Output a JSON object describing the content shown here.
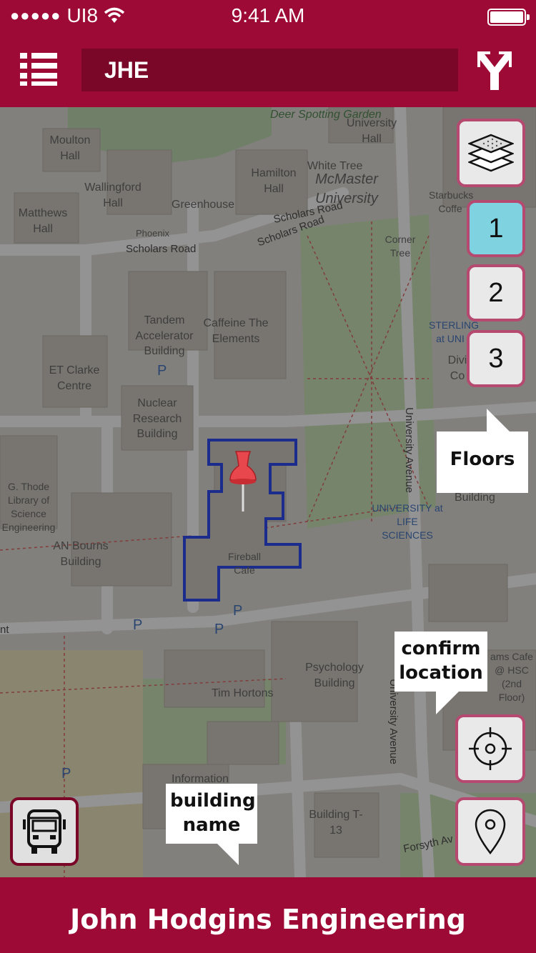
{
  "status_bar": {
    "carrier": "UI8",
    "signal_dots": "●●●●●",
    "time": "9:41 AM"
  },
  "nav": {
    "menu_icon": "list-icon",
    "search_value": "JHE",
    "directions_icon": "directions-icon"
  },
  "map": {
    "labels": {
      "deer_garden": "Deer Spotting Garden",
      "university_hall": "University Hall",
      "moulton_hall": "Moulton Hall",
      "wallingford_hall": "Wallingford Hall",
      "hamilton_hall": "Hamilton Hall",
      "white_tree": "White Tree",
      "mcmaster": "McMaster University",
      "greenhouse": "Greenhouse",
      "phoenix": "Phoenix",
      "matthews_hall": "Matthews Hall",
      "scholars_road_1": "Scholars Road",
      "scholars_road_2": "Scholars Road",
      "scholars_road_3": "Scholars Road",
      "starbucks": "Starbucks Coffe",
      "corner_tree": "Corner Tree",
      "tandem": "Tandem Accelerator Building",
      "caffeine": "Caffeine The Elements",
      "et_clarke": "ET Clarke Centre",
      "sterling": "STERLING at UNI",
      "divi": "Divi Co",
      "nuclear": "Nuclear Research Building",
      "university_avenue": "University Avenue",
      "thode": "G. Thode Library of Science Engineering",
      "building": "Building",
      "univ_life": "UNIVERSITY at LIFE SCIENCES",
      "an_bourns": "AN Bourns Building",
      "fireball": "Fireball Cafe",
      "psychology": "Psychology Building",
      "tim_hortons": "Tim Hortons",
      "information": "Information",
      "building_t13": "Building T-13",
      "forsyth": "Forsyth Av",
      "hsc_cafe": "ams Cafe @ HSC (2nd Floor)",
      "nt": "nt",
      "parking": "P"
    }
  },
  "controls": {
    "layers_icon": "layers-icon",
    "floors": [
      "1",
      "2",
      "3"
    ],
    "active_floor": "1",
    "locate_icon": "crosshair-icon",
    "pin_icon": "map-pin-icon",
    "bus_icon": "bus-icon"
  },
  "callouts": {
    "floors": "Floors",
    "confirm_line1": "confirm",
    "confirm_line2": "location",
    "building_line1": "building",
    "building_line2": "name"
  },
  "bottom_bar": {
    "building_name": "John Hodgins Engineering"
  },
  "colors": {
    "brand": "#9d0a35",
    "brand_dark": "#7a0628",
    "active_floor": "#7fd3e0",
    "outline": "#1030f0",
    "button_border": "#b6496f"
  }
}
